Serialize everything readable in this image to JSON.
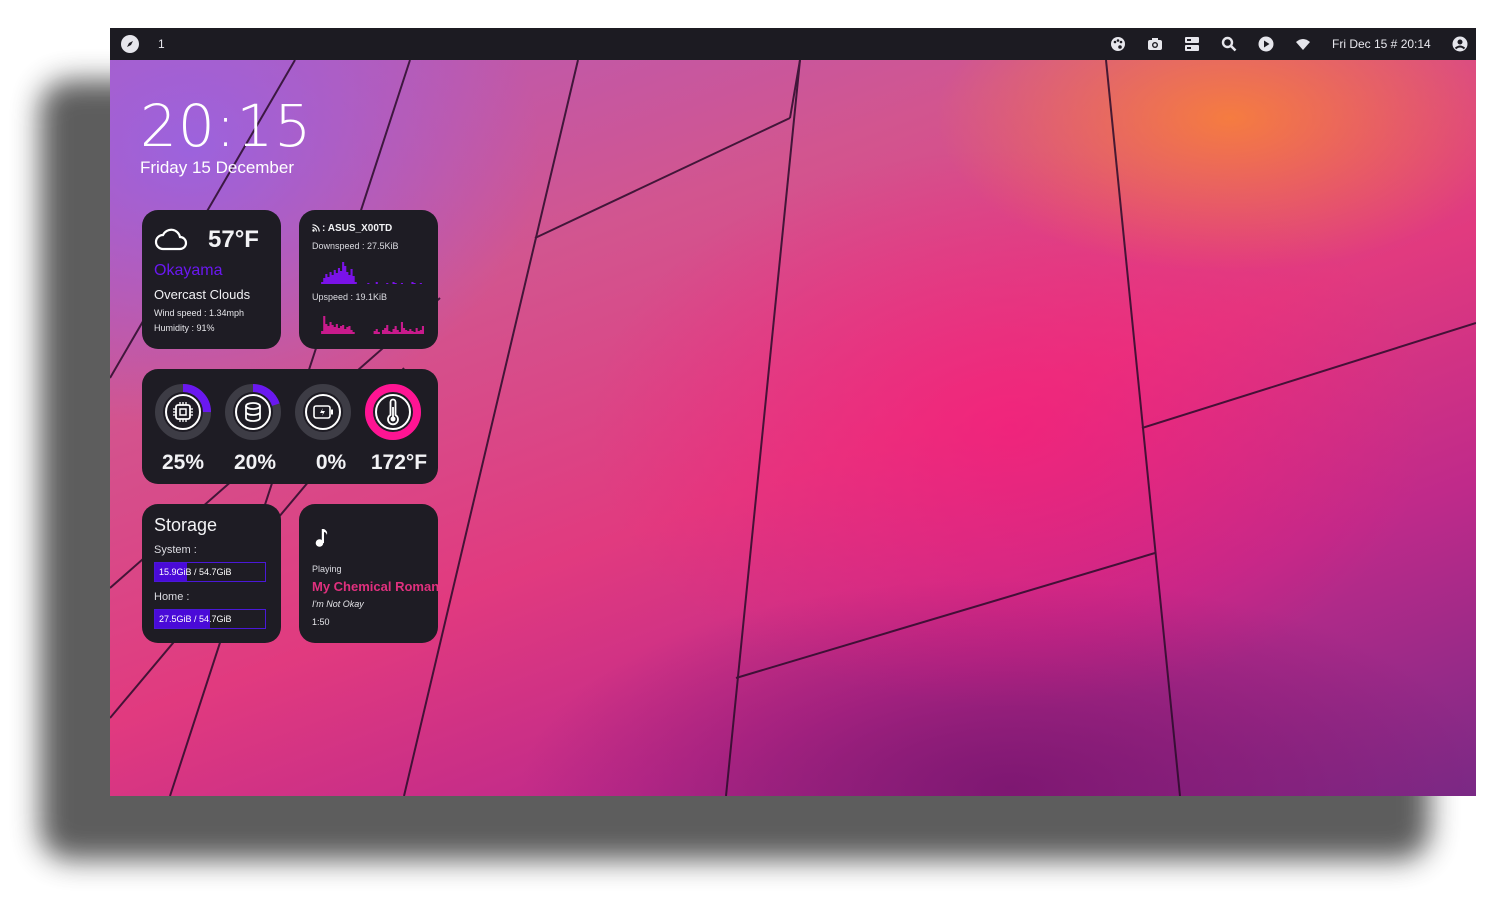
{
  "topbar": {
    "workspace": "1",
    "clock": "Fri Dec 15 # 20:14",
    "icons": [
      "palette-icon",
      "camera-icon",
      "server-icon",
      "search-icon",
      "play-icon",
      "wifi-icon",
      "user-icon"
    ]
  },
  "clock": {
    "time": "20:15",
    "date": "Friday 15 December"
  },
  "weather": {
    "icon": "cloud-icon",
    "temp": "57°F",
    "city": "Okayama",
    "condition": "Overcast Clouds",
    "wind": "Wind speed : 1.34mph",
    "humidity": "Humidity : 91%"
  },
  "network": {
    "ssid": ": ASUS_X00TD",
    "down": "Downspeed : 27.5KiB",
    "up": "Upspeed : 19.1KiB",
    "down_color": "#7a12e8",
    "up_color": "#c81a8c"
  },
  "stats": [
    {
      "icon": "cpu-icon",
      "value": "25%",
      "fraction": 0.25,
      "color": "#6a18f0"
    },
    {
      "icon": "database-icon",
      "value": "20%",
      "fraction": 0.2,
      "color": "#6a18f0"
    },
    {
      "icon": "battery-charging-icon",
      "value": "0%",
      "fraction": 0.0,
      "color": "#6a18f0"
    },
    {
      "icon": "thermometer-icon",
      "value": "172°F",
      "fraction": 1.0,
      "color": "#ff1493"
    }
  ],
  "storage": {
    "title": "Storage",
    "system_label": "System :",
    "system_value": "15.9GiB / 54.7GiB",
    "system_fraction": 0.29,
    "home_label": "Home :",
    "home_value": "27.5GiB / 54.7GiB",
    "home_fraction": 0.5
  },
  "music": {
    "icon": "music-note-icon",
    "status": "Playing",
    "artist": "My Chemical Romance",
    "song": "I'm Not Okay",
    "time": "1:50"
  }
}
